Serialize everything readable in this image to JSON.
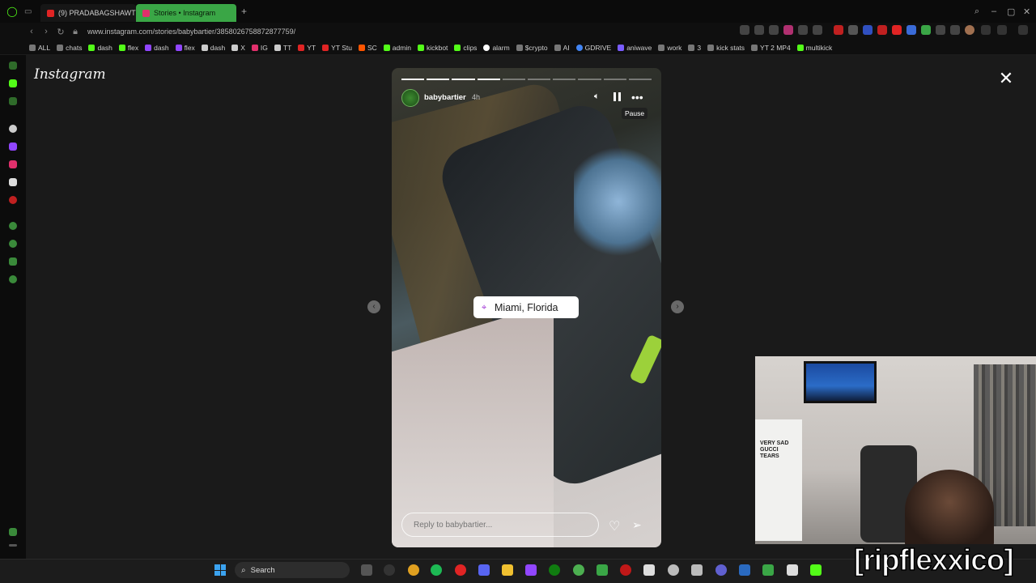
{
  "browser": {
    "tabs": [
      {
        "label": "(9) PRADABAGSHAWTY",
        "favicon_color": "#e02424"
      },
      {
        "label": "Stories • Instagram",
        "favicon_color": "#e1306c"
      }
    ],
    "new_tab_label": "+",
    "url": "www.instagram.com/stories/babybartier/3858026758872877759/"
  },
  "bookmarks": [
    {
      "label": "ALL",
      "color": "#777"
    },
    {
      "label": "chats",
      "color": "#777"
    },
    {
      "label": "dash",
      "color": "#53fc18"
    },
    {
      "label": "flex",
      "color": "#53fc18"
    },
    {
      "label": "dash",
      "color": "#9146ff"
    },
    {
      "label": "flex",
      "color": "#9146ff"
    },
    {
      "label": "dash",
      "color": "#ccc"
    },
    {
      "label": "X",
      "color": "#ccc"
    },
    {
      "label": "IG",
      "color": "#e1306c"
    },
    {
      "label": "TT",
      "color": "#ccc"
    },
    {
      "label": "YT",
      "color": "#e02424"
    },
    {
      "label": "YT Stu",
      "color": "#e02424"
    },
    {
      "label": "SC",
      "color": "#ff5500"
    },
    {
      "label": "admin",
      "color": "#53fc18"
    },
    {
      "label": "kickbot",
      "color": "#53fc18"
    },
    {
      "label": "clips",
      "color": "#53fc18"
    },
    {
      "label": "alarm",
      "color": "#fff"
    },
    {
      "label": "$crypto",
      "color": "#777"
    },
    {
      "label": "AI",
      "color": "#777"
    },
    {
      "label": "GDRIVE",
      "color": "#4285f4"
    },
    {
      "label": "aniwave",
      "color": "#7a5cff"
    },
    {
      "label": "work",
      "color": "#777"
    },
    {
      "label": "3",
      "color": "#777"
    },
    {
      "label": "kick stats",
      "color": "#777"
    },
    {
      "label": "YT 2 MP4",
      "color": "#777"
    },
    {
      "label": "multikick",
      "color": "#53fc18"
    }
  ],
  "instagram": {
    "logo": "Instagram",
    "story": {
      "username": "babybartier",
      "time_ago": "4h",
      "progress_segments": 10,
      "segments_done": 4,
      "location": "Miami, Florida",
      "tooltip": "Pause",
      "reply_placeholder": "Reply to babybartier..."
    }
  },
  "webcam": {
    "shirt_text": "VERY SAD GUCCI TEARS"
  },
  "stream_tag": "[ripflexxico]",
  "taskbar": {
    "search_label": "Search"
  },
  "icons": {
    "close": "close-icon",
    "volume": "volume-icon",
    "pause": "pause-icon",
    "more": "more-icon",
    "heart": "heart-icon",
    "send": "send-icon"
  }
}
